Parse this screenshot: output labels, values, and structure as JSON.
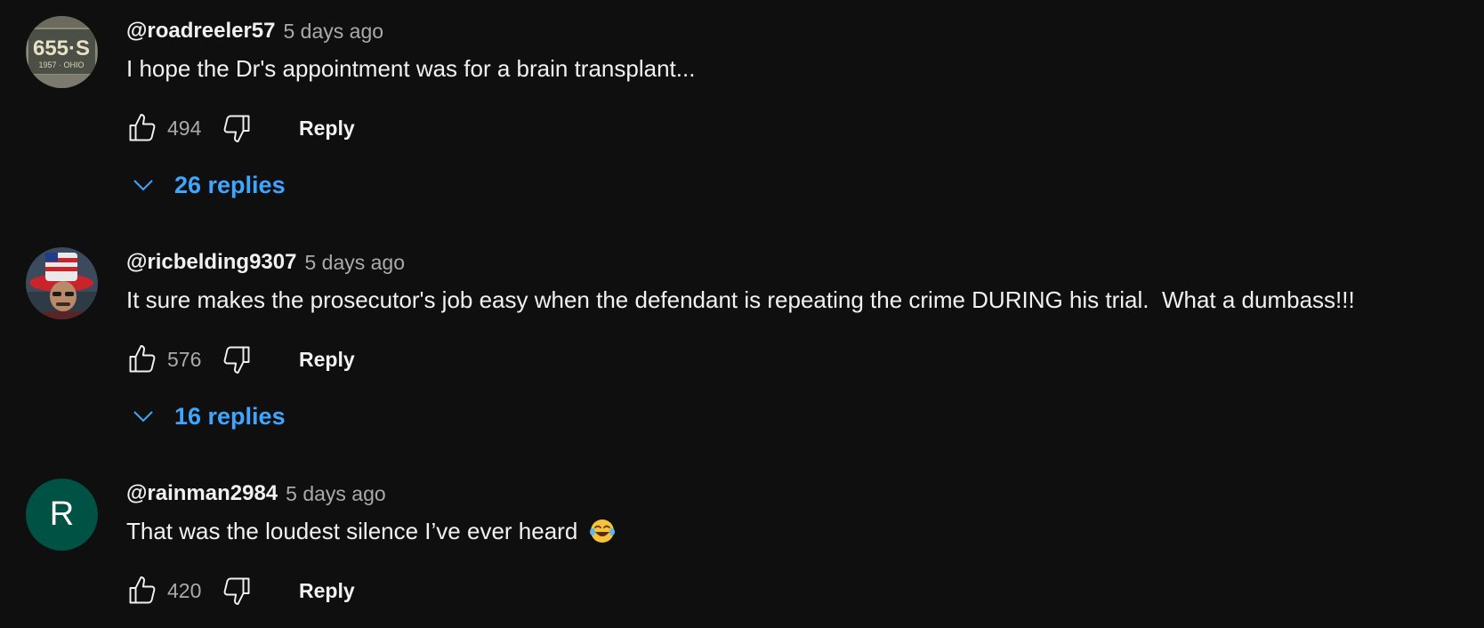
{
  "comments": [
    {
      "author": "@roadreeler57",
      "time": "5 days ago",
      "text": "I hope the Dr's appointment was for a brain transplant...",
      "likes": "494",
      "reply_label": "Reply",
      "replies_label": "26 replies",
      "avatar": {
        "type": "image",
        "depicts": "license plate",
        "plate_text": "655·S",
        "plate_subtext": "1957 · OHIO"
      }
    },
    {
      "author": "@ricbelding9307",
      "time": "5 days ago",
      "text": "It sure makes the prosecutor's job easy when the defendant is repeating the crime DURING his trial.  What a dumbass!!!",
      "likes": "576",
      "reply_label": "Reply",
      "replies_label": "16 replies",
      "avatar": {
        "type": "image",
        "depicts": "man in uncle sam hat"
      }
    },
    {
      "author": "@rainman2984",
      "time": "5 days ago",
      "text": "That was the loudest silence I’ve ever heard",
      "emoji": "face-with-tears-of-joy",
      "likes": "420",
      "reply_label": "Reply",
      "avatar": {
        "type": "letter",
        "letter": "R",
        "color": "#005244"
      }
    }
  ],
  "colors": {
    "background": "#0f0f0f",
    "primary_text": "#f1f1f1",
    "secondary_text": "#aaaaaa",
    "link": "#3ea6ff"
  },
  "icons": [
    "like-icon",
    "dislike-icon",
    "chevron-down-icon"
  ]
}
